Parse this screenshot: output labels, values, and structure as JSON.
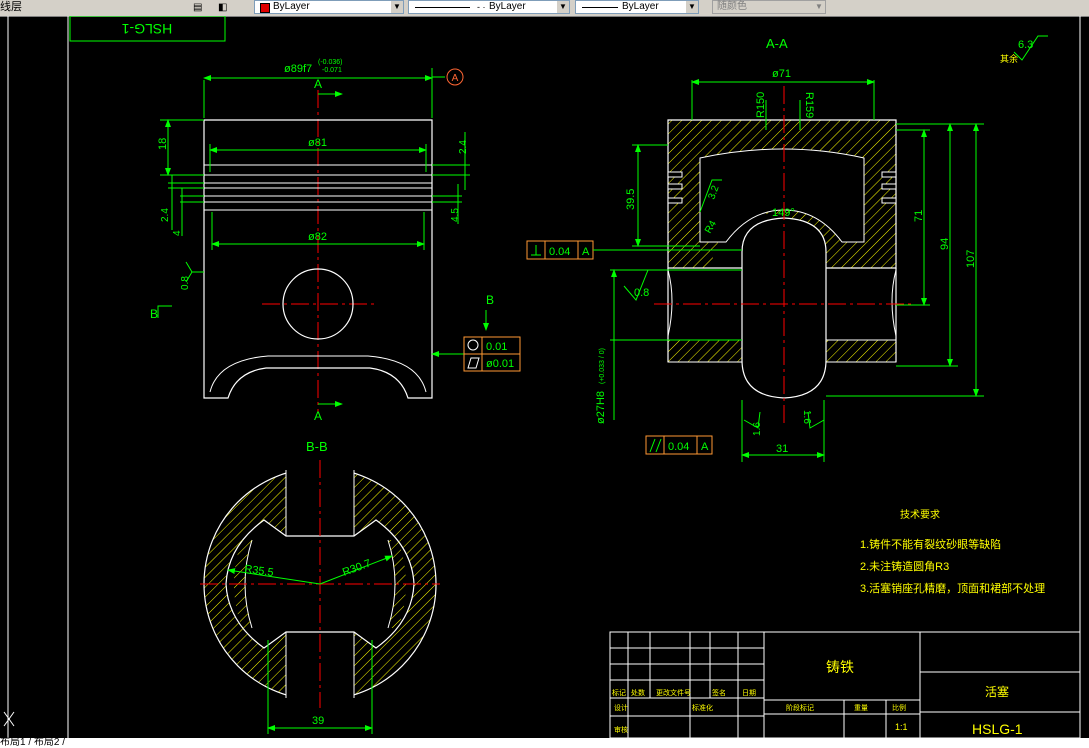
{
  "toolbar": {
    "layer_label": "线层",
    "color_value": "ByLayer",
    "color_swatch": "#e00000",
    "linetype_value": "ByLayer",
    "lineweight_value": "ByLayer",
    "plotstyle_value": "随颜色"
  },
  "drawing": {
    "title_block_frame_text": "HSLG-1",
    "section_aa": "A-A",
    "section_bb": "B-B",
    "roughness_note": "其余",
    "roughness_value": "6.3",
    "dims": {
      "d89": "ø89f7",
      "d89_tol_upper": "(-0.036)",
      "d89_tol_lower": "-0.071",
      "datum_a": "A",
      "cut_a": "A",
      "cut_b": "B",
      "d81": "ø81",
      "d82": "ø82",
      "h18": "18",
      "h24a": "2.4",
      "h24b": "2.4",
      "h4": "4",
      "h45": "4.5",
      "r08": "0.8",
      "round_tol": "0.01",
      "cyl_tol": "ø0.01",
      "d71": "ø71",
      "r150": "R150",
      "r159": "R159",
      "h395": "39.5",
      "h32": "3.2",
      "r4": "R4",
      "a149": "149°",
      "h71": "71",
      "h94": "94",
      "h107": "107",
      "perp_tol": "0.04",
      "perp_datum": "A",
      "r08b": "0.8",
      "d27": "ø27H8",
      "d27_tol": "(+0.033 / 0)",
      "r16a": "1.6",
      "r16b": "1.6",
      "par_tol": "0.04",
      "par_datum": "A",
      "w31": "31",
      "r355": "R35.5",
      "r307": "R30.7",
      "w39": "39"
    },
    "tech_req": {
      "title": "技术要求",
      "item1": "1.铸件不能有裂纹砂眼等缺陷",
      "item2": "2.未注铸造圆角R3",
      "item3": "3.活塞销座孔精磨，顶面和裙部不处理"
    },
    "title_block": {
      "material": "铸铁",
      "part_name": "活塞",
      "drawing_no": "HSLG-1",
      "scale": "1:1",
      "scale_label": "比例",
      "weight_label": "重量",
      "stage_label": "阶段标记",
      "row_label1": "标记",
      "row_label2": "处数",
      "row_label3": "更改文件号",
      "row_label4": "签名",
      "row_label5": "日期",
      "designer": "设计",
      "standardize": "标准化",
      "review": "审核"
    }
  },
  "statusbar": {
    "layout_tabs": "布局1 / 布局2 /"
  },
  "colors": {
    "background": "#000000",
    "object_white": "#ffffff",
    "dimension_green": "#00ff00",
    "centerline_red": "#ff0000",
    "hatch_yellow": "#ffff00",
    "tolerance_orange": "#ff9933",
    "datum_orange": "#ff6633",
    "dim_cyan": "#00ffff"
  }
}
